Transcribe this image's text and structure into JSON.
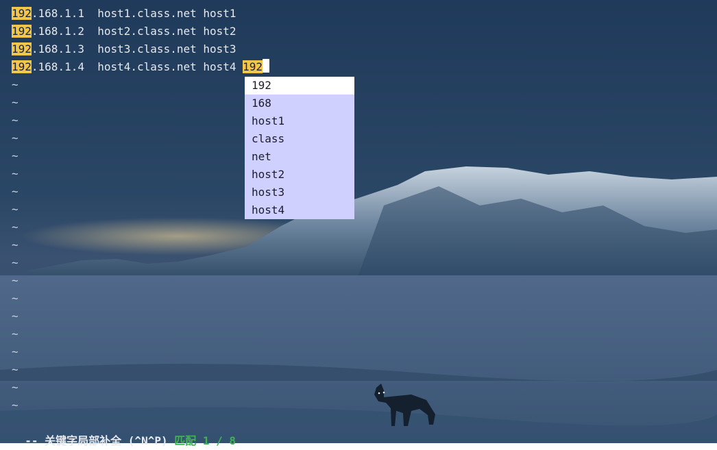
{
  "editor": {
    "lines": [
      {
        "match": "192",
        "rest": ".168.1.1  host1.class.net host1",
        "typed": ""
      },
      {
        "match": "192",
        "rest": ".168.1.2  host2.class.net host2",
        "typed": ""
      },
      {
        "match": "192",
        "rest": ".168.1.3  host3.class.net host3",
        "typed": ""
      },
      {
        "match": "192",
        "rest": ".168.1.4  host4.class.net host4 ",
        "typed": "192"
      }
    ],
    "empty_line_marker": "~",
    "empty_line_count": 19
  },
  "completion_menu": {
    "items": [
      "192",
      "168",
      "host1",
      "class",
      "net",
      "host2",
      "host3",
      "host4"
    ],
    "selected_index": 0
  },
  "statusline": {
    "mode_text": "-- 关键字局部补全 (^N^P) ",
    "match_text": "匹配 1 / 8"
  },
  "colors": {
    "search_highlight": "#f2c64a",
    "popup_background": "#cfd0fd",
    "popup_selected": "#ffffff",
    "status_match": "#3fb34f"
  }
}
